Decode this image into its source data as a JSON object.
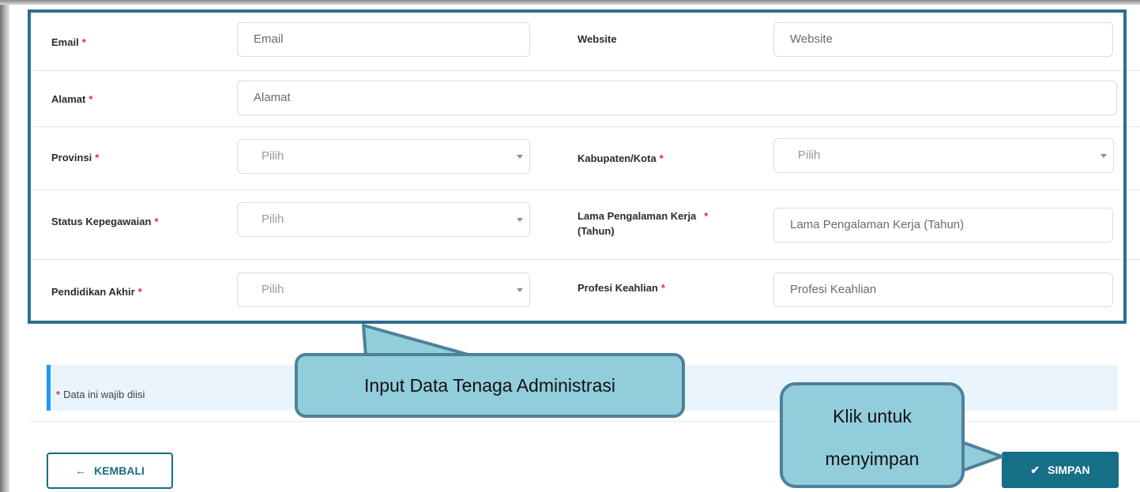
{
  "form": {
    "email": {
      "label": "Email",
      "placeholder": "Email"
    },
    "website": {
      "label": "Website",
      "placeholder": "Website"
    },
    "alamat": {
      "label": "Alamat",
      "placeholder": "Alamat"
    },
    "provinsi": {
      "label": "Provinsi",
      "value": "Pilih"
    },
    "kabupaten": {
      "label": "Kabupaten/Kota",
      "value": "Pilih"
    },
    "status": {
      "label": "Status Kepegawaian",
      "value": "Pilih"
    },
    "lama": {
      "label_line1": "Lama Pengalaman Kerja",
      "label_line2": "(Tahun)",
      "placeholder": "Lama Pengalaman Kerja (Tahun)"
    },
    "pendidikan": {
      "label": "Pendidikan Akhir",
      "value": "Pilih"
    },
    "profesi": {
      "label": "Profesi Keahlian",
      "placeholder": "Profesi Keahlian"
    },
    "required_mark": "*"
  },
  "notice": {
    "text": "Data ini wajib diisi"
  },
  "buttons": {
    "back": "KEMBALI",
    "save": "SIMPAN"
  },
  "callouts": {
    "input": "Input Data Tenaga Administrasi",
    "save_line1": "Klik untuk",
    "save_line2": "menyimpan"
  },
  "icons": {
    "back": "arrow-left-icon",
    "save": "check-icon",
    "dropdown": "caret-down-icon"
  },
  "colors": {
    "accent": "#166f86",
    "required": "#e0245e",
    "notice_bar": "#2196f3",
    "callout_fill": "#92cddc",
    "callout_border": "#4f8099",
    "highlight_border": "#2e6e8c"
  }
}
